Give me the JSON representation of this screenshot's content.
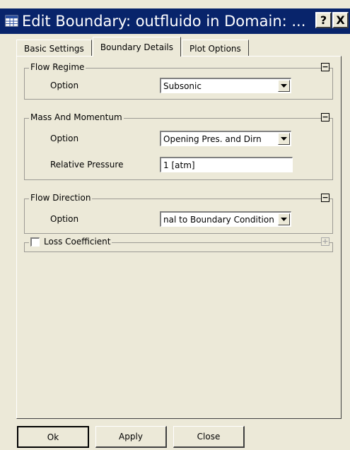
{
  "window": {
    "title": "Edit Boundary: outfluido in Domain: ...",
    "help_label": "?",
    "close_label": "X"
  },
  "tabs": [
    {
      "label": "Basic Settings",
      "active": false
    },
    {
      "label": "Boundary Details",
      "active": true
    },
    {
      "label": "Plot Options",
      "active": false
    }
  ],
  "flow_regime": {
    "title": "Flow Regime",
    "option_label": "Option",
    "option_value": "Subsonic"
  },
  "mass_momentum": {
    "title": "Mass And Momentum",
    "option_label": "Option",
    "option_value": "Opening Pres. and Dirn",
    "pressure_label": "Relative Pressure",
    "pressure_value": "1 [atm]"
  },
  "flow_direction": {
    "title": "Flow Direction",
    "option_label": "Option",
    "option_value": "nal to Boundary Condition"
  },
  "loss_coefficient": {
    "title": "Loss Coefficient",
    "checked": false
  },
  "buttons": {
    "ok": "Ok",
    "apply": "Apply",
    "close": "Close"
  },
  "colors": {
    "titlebar": "#08246b",
    "face": "#ece9d8"
  },
  "icons": {
    "app": "grid-window-icon",
    "collapse": "minus-box-icon",
    "expand": "plus-box-icon",
    "dropdown": "triangle-down-icon"
  }
}
